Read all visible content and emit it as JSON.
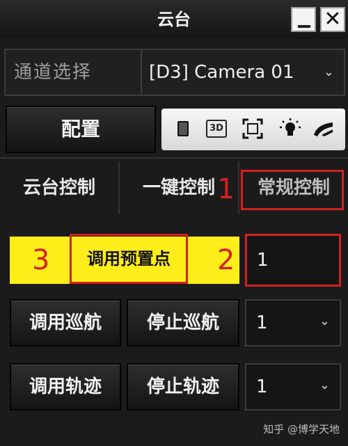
{
  "window": {
    "title": "云台"
  },
  "channel": {
    "label": "通道选择",
    "value": "[D3] Camera 01"
  },
  "config": {
    "label": "配置"
  },
  "toolbar": {
    "icon_3d_label": "3D"
  },
  "tabs": [
    {
      "label": "云台控制"
    },
    {
      "label": "一键控制"
    },
    {
      "label": "常规控制",
      "active": true
    }
  ],
  "preset": {
    "call_label": "调用预置点",
    "value": "1"
  },
  "cruise": {
    "call_label": "调用巡航",
    "stop_label": "停止巡航",
    "value": "1"
  },
  "track": {
    "call_label": "调用轨迹",
    "stop_label": "停止轨迹",
    "value": "1"
  },
  "annotations": {
    "mark1": "1",
    "mark2": "2",
    "mark3": "3"
  },
  "watermark": "知乎 @博学天地",
  "colors": {
    "highlight": "#ffee1a",
    "annotation_red": "#d42020",
    "background": "#1b1b1b"
  },
  "icons": [
    "minimize-icon",
    "close-icon",
    "chevron-down-icon",
    "square-icon",
    "3d-icon",
    "focus-frame-icon",
    "light-bulb-icon",
    "wiper-icon"
  ]
}
